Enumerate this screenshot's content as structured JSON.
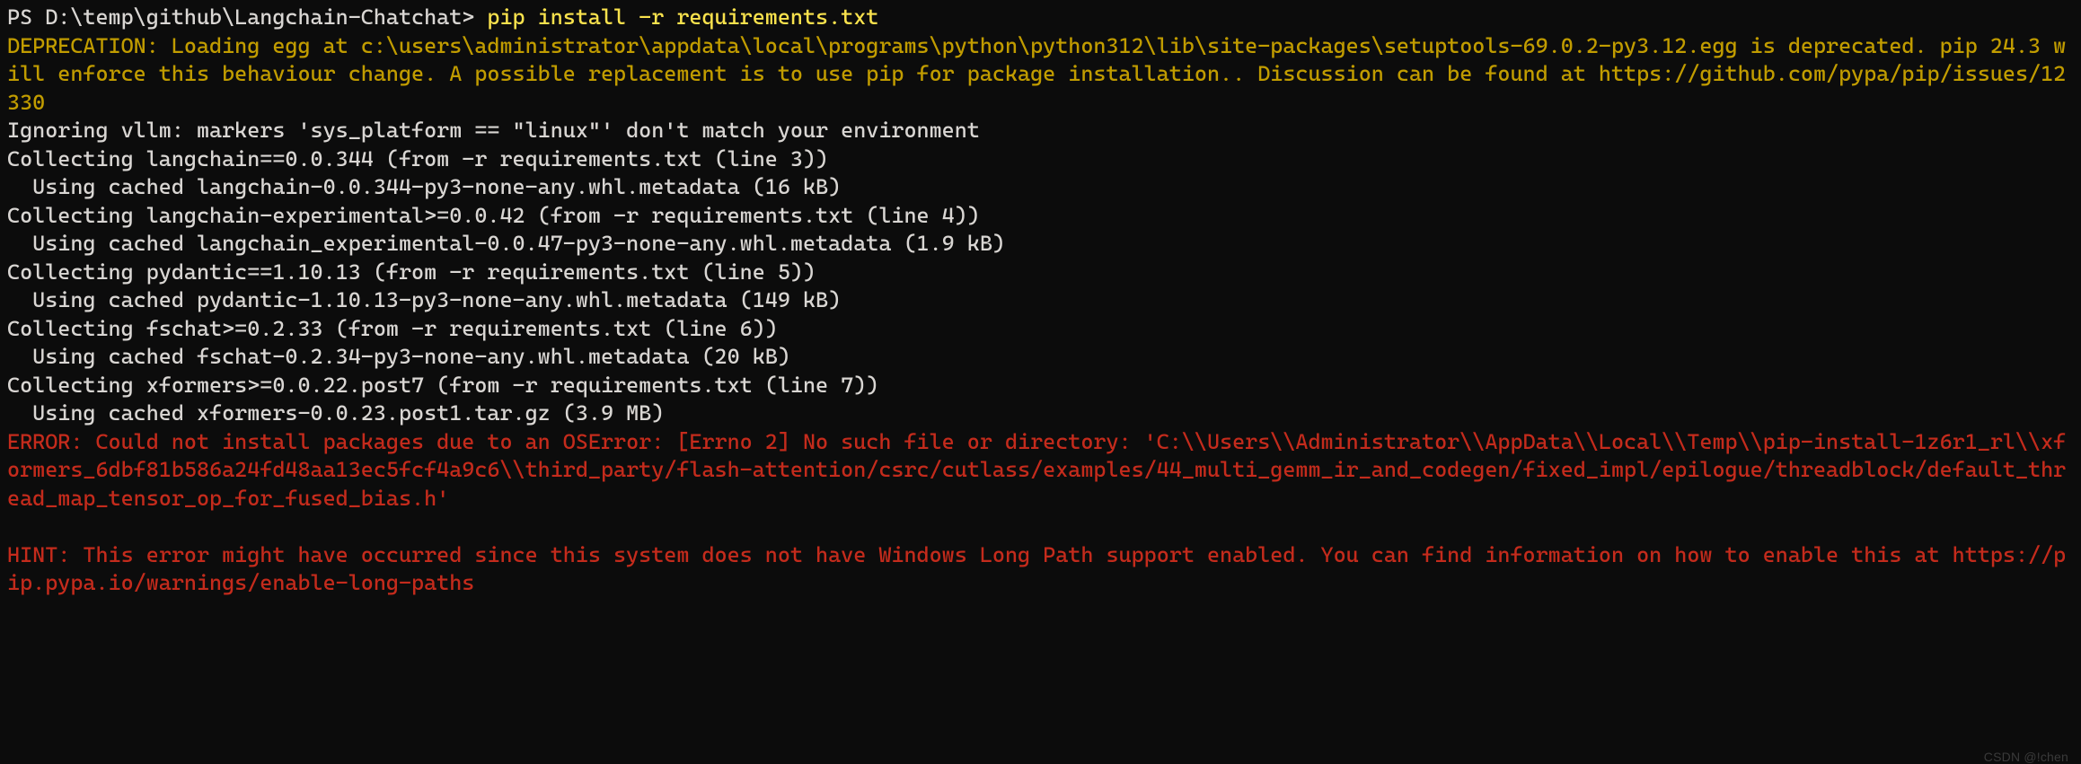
{
  "prompt": {
    "ps": "PS D:\\temp\\github\\Langchain-Chatchat> ",
    "command": "pip install -r requirements.txt"
  },
  "lines": [
    {
      "cls": "c-yellow",
      "text": "DEPRECATION: Loading egg at c:\\users\\administrator\\appdata\\local\\programs\\python\\python312\\lib\\site-packages\\setuptools-69.0.2-py3.12.egg is deprecated. pip 24.3 will enforce this behaviour change. A possible replacement is to use pip for package installation.. Discussion can be found at https://github.com/pypa/pip/issues/12330"
    },
    {
      "cls": "c-white",
      "text": "Ignoring vllm: markers 'sys_platform == \"linux\"' don't match your environment"
    },
    {
      "cls": "c-white",
      "text": "Collecting langchain==0.0.344 (from -r requirements.txt (line 3))"
    },
    {
      "cls": "c-white",
      "text": "  Using cached langchain-0.0.344-py3-none-any.whl.metadata (16 kB)"
    },
    {
      "cls": "c-white",
      "text": "Collecting langchain-experimental>=0.0.42 (from -r requirements.txt (line 4))"
    },
    {
      "cls": "c-white",
      "text": "  Using cached langchain_experimental-0.0.47-py3-none-any.whl.metadata (1.9 kB)"
    },
    {
      "cls": "c-white",
      "text": "Collecting pydantic==1.10.13 (from -r requirements.txt (line 5))"
    },
    {
      "cls": "c-white",
      "text": "  Using cached pydantic-1.10.13-py3-none-any.whl.metadata (149 kB)"
    },
    {
      "cls": "c-white",
      "text": "Collecting fschat>=0.2.33 (from -r requirements.txt (line 6))"
    },
    {
      "cls": "c-white",
      "text": "  Using cached fschat-0.2.34-py3-none-any.whl.metadata (20 kB)"
    },
    {
      "cls": "c-white",
      "text": "Collecting xformers>=0.0.22.post7 (from -r requirements.txt (line 7))"
    },
    {
      "cls": "c-white",
      "text": "  Using cached xformers-0.0.23.post1.tar.gz (3.9 MB)"
    },
    {
      "cls": "c-red",
      "text": "ERROR: Could not install packages due to an OSError: [Errno 2] No such file or directory: 'C:\\\\Users\\\\Administrator\\\\AppData\\\\Local\\\\Temp\\\\pip-install-1z6r1_rl\\\\xformers_6dbf81b586a24fd48aa13ec5fcf4a9c6\\\\third_party/flash-attention/csrc/cutlass/examples/44_multi_gemm_ir_and_codegen/fixed_impl/epilogue/threadblock/default_thread_map_tensor_op_for_fused_bias.h'"
    },
    {
      "cls": "c-red",
      "text": ""
    },
    {
      "cls": "c-red",
      "text": "HINT: This error might have occurred since this system does not have Windows Long Path support enabled. You can find information on how to enable this at https://pip.pypa.io/warnings/enable-long-paths"
    }
  ],
  "watermark": "CSDN @!chen"
}
